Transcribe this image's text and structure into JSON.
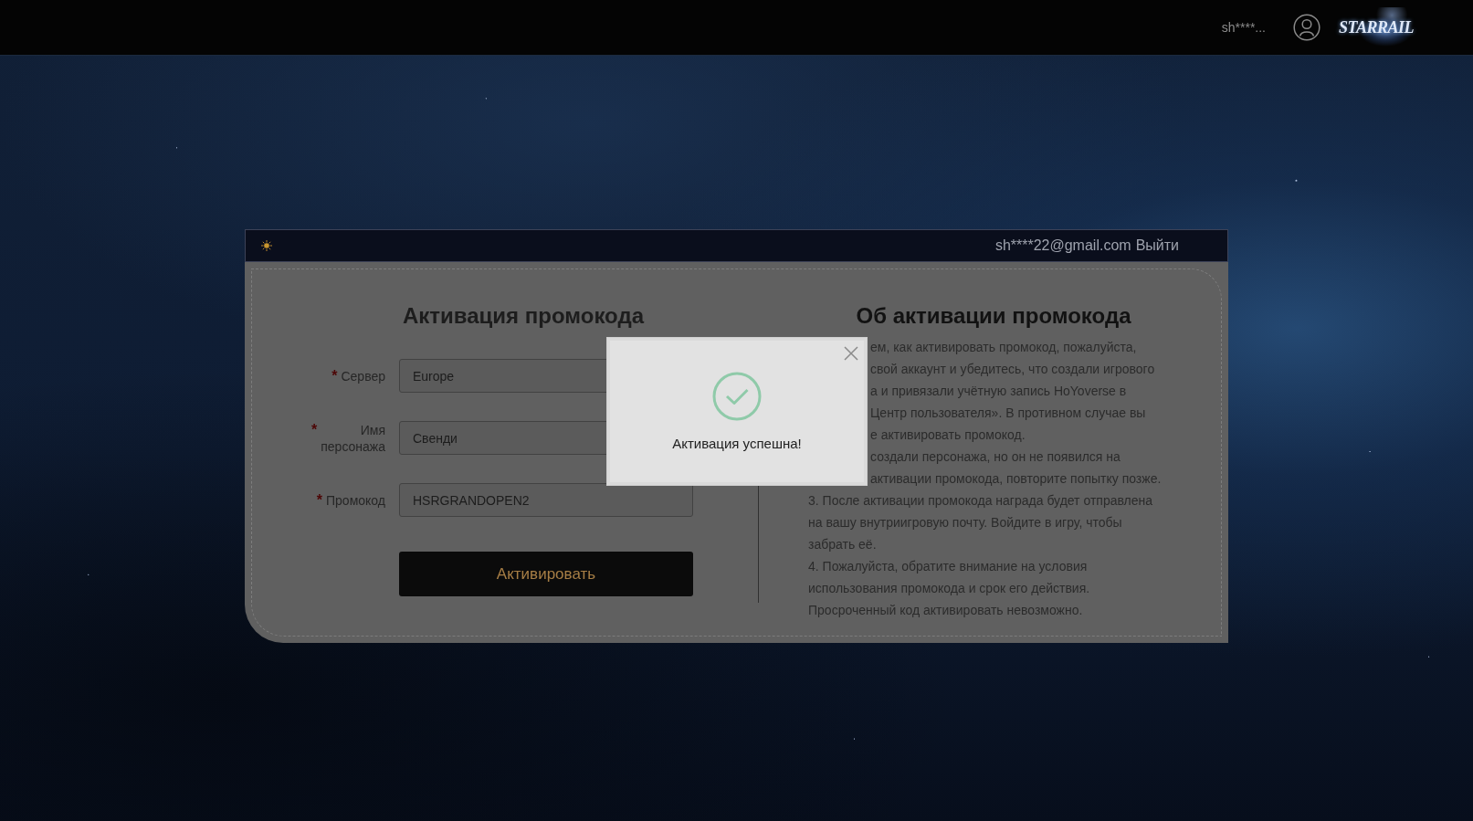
{
  "top_bar": {
    "username": "sh****...",
    "logo": "STARRAIL"
  },
  "panel": {
    "account": "sh****22@gmail.com",
    "logout": "Выйти"
  },
  "form": {
    "title": "Активация промокода",
    "fields": [
      {
        "mark": "*",
        "label": "Сервер",
        "value": "Europe"
      },
      {
        "mark": "*",
        "label": "Имя персонажа",
        "value": "Свенди"
      },
      {
        "mark": "*",
        "label": "Промокод",
        "value": "HSRGRANDOPEN2"
      }
    ],
    "submit": "Активировать"
  },
  "about": {
    "title": "Об активации промокода",
    "items": [
      {
        "kind": "fragment",
        "text": "ем, как активировать промокод, пожалуйста,"
      },
      {
        "kind": "fragment",
        "text": "свой аккаунт и убедитесь, что создали игрового"
      },
      {
        "kind": "fragment",
        "text": "а и привязали учётную запись HoYoverse в"
      },
      {
        "kind": "fragment",
        "text": "Центр пользователя». В противном случае вы"
      },
      {
        "kind": "fragment",
        "text": "е активировать промокод."
      },
      {
        "kind": "fragment",
        "text": "создали персонажа, но он не появился на"
      },
      {
        "kind": "fragment",
        "text": "активации промокода, повторите попытку позже."
      },
      {
        "kind": "paragraph",
        "text": "3. После активации промокода награда будет отправлена на вашу внутриигровую почту. Войдите в игру, чтобы забрать её."
      },
      {
        "kind": "paragraph",
        "text": "4. Пожалуйста, обратите внимание на условия использования промокода и срок его действия. Просроченный код активировать невозможно."
      }
    ]
  },
  "dialog": {
    "message": "Активация успешна!"
  }
}
